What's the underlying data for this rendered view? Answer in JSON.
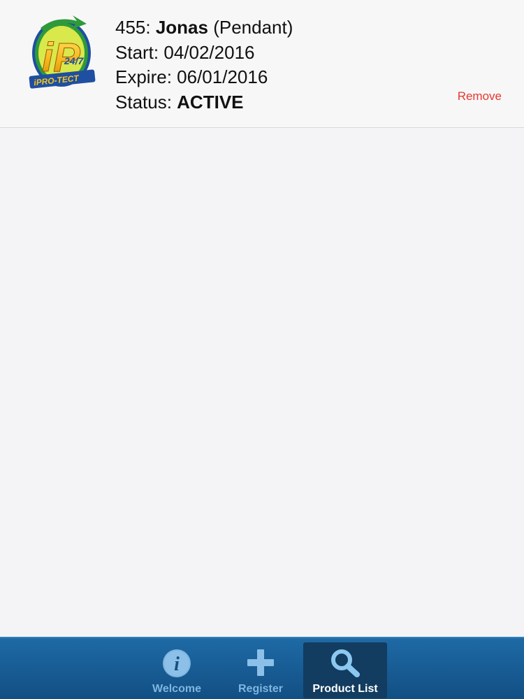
{
  "product": {
    "id_prefix": "455: ",
    "name": "Jonas",
    "type": " (Pendant)",
    "start_label": "Start: ",
    "start_date": "04/02/2016",
    "expire_label": "Expire: ",
    "expire_date": "06/01/2016",
    "status_label": "Status: ",
    "status_value": "ACTIVE",
    "remove_label": "Remove",
    "logo_text": "iPRO-TECT 24/7"
  },
  "tabbar": {
    "tabs": [
      {
        "label": "Welcome",
        "icon": "info-icon",
        "active": false
      },
      {
        "label": "Register",
        "icon": "plus-icon",
        "active": false
      },
      {
        "label": "Product List",
        "icon": "search-icon",
        "active": true
      }
    ]
  },
  "colors": {
    "remove": "#e8372e",
    "tabbar": "#1a5f98",
    "tab_active": "#123c60",
    "tab_inactive_label": "#7fb5e0"
  }
}
